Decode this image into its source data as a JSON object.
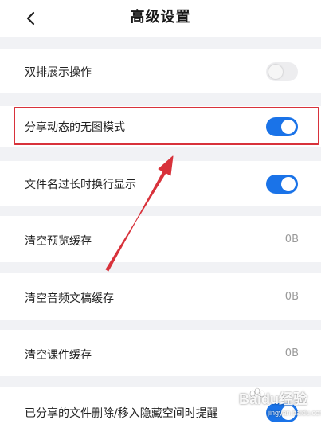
{
  "header": {
    "title": "高级设置",
    "back_icon": "chevron-left-icon"
  },
  "settings": [
    {
      "label": "双排展示操作",
      "type": "toggle",
      "enabled": false
    },
    {
      "label": "分享动态的无图模式",
      "type": "toggle",
      "enabled": true
    },
    {
      "label": "文件名过长时换行显示",
      "type": "toggle",
      "enabled": true
    },
    {
      "label": "清空预览缓存",
      "type": "value",
      "value": "0B"
    },
    {
      "label": "清空音频文稿缓存",
      "type": "value",
      "value": "0B"
    },
    {
      "label": "清空课件缓存",
      "type": "value",
      "value": "0B"
    },
    {
      "label": "已分享的文件删除/移入隐藏空间时提醒",
      "type": "toggle",
      "enabled": true
    }
  ],
  "annotation": {
    "highlight_color": "#d8323b",
    "arrow_color": "#d8323b"
  },
  "watermark": {
    "text": "Baidu经验",
    "subtext": "jingyan.baidu.com"
  },
  "colors": {
    "accent": "#1a73e8",
    "toggle_off": "#ededef",
    "background": "#f1f2f5"
  }
}
